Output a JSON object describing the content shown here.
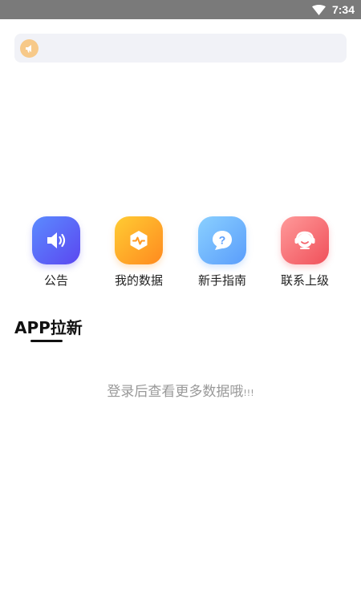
{
  "status_bar": {
    "time": "7:34",
    "icons": [
      "wifi-icon"
    ]
  },
  "notice": {
    "icon": "megaphone-icon",
    "text": ""
  },
  "quick_menu": [
    {
      "label": "公告",
      "icon": "speaker-icon",
      "color": "#5b5cf6"
    },
    {
      "label": "我的数据",
      "icon": "data-chart-icon",
      "color": "#ffa12a"
    },
    {
      "label": "新手指南",
      "icon": "question-bubble-icon",
      "color": "#6ab2fc"
    },
    {
      "label": "联系上级",
      "icon": "headset-icon",
      "color": "#f5636b"
    }
  ],
  "section": {
    "title": "APP拉新"
  },
  "empty_state": {
    "message": "登录后查看更多数据哦",
    "suffix": "!!!"
  }
}
